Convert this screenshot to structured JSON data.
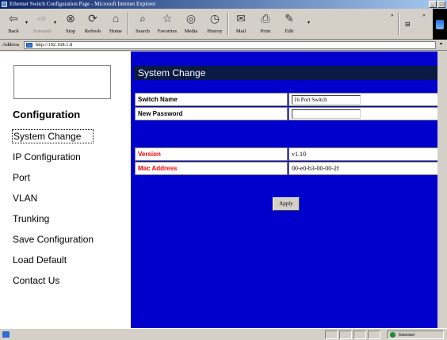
{
  "window": {
    "title": "Ethernet Switch Configuration Page - Microsoft Internet Explorer",
    "controls": [
      "_",
      "□"
    ]
  },
  "toolbar": {
    "buttons": [
      {
        "label": "Back",
        "icon": "back-arrow-icon",
        "glyph": "⇦"
      },
      {
        "label": "Forward",
        "icon": "forward-arrow-icon",
        "glyph": "⇨"
      },
      {
        "label": "Stop",
        "icon": "stop-icon",
        "glyph": "⊗"
      },
      {
        "label": "Refresh",
        "icon": "refresh-icon",
        "glyph": "⟳"
      },
      {
        "label": "Home",
        "icon": "home-icon",
        "glyph": "⌂"
      },
      {
        "label": "Search",
        "icon": "search-icon",
        "glyph": "⌕"
      },
      {
        "label": "Favorites",
        "icon": "favorites-icon",
        "glyph": "☆"
      },
      {
        "label": "Media",
        "icon": "media-icon",
        "glyph": "◎"
      },
      {
        "label": "History",
        "icon": "history-icon",
        "glyph": "◷"
      },
      {
        "label": "Mail",
        "icon": "mail-icon",
        "glyph": "✉"
      },
      {
        "label": "Print",
        "icon": "print-icon",
        "glyph": "⎙"
      },
      {
        "label": "Edit",
        "icon": "edit-icon",
        "glyph": "✎"
      }
    ]
  },
  "address": {
    "label": "Address",
    "url": "http://192.168.1.8"
  },
  "sidebar": {
    "section_title": "Configuration",
    "items": [
      "System Change",
      "IP Configuration",
      "Port",
      "VLAN",
      "Trunking",
      "Save Configuration",
      "Load Default",
      "Contact Us"
    ]
  },
  "main": {
    "title": "System Change",
    "switch_name_label": "Switch Name",
    "switch_name_value": "16 Port Switch",
    "new_password_label": "New Password",
    "new_password_value": "",
    "version_label": "Version",
    "version_value": "v1.10",
    "mac_label": "Mac Address",
    "mac_value": "00-e0-b3-00-00-2f",
    "apply_label": "Apply"
  },
  "status": {
    "zone": "Internet"
  },
  "colors": {
    "main_bg": "#0000cc",
    "title_bar_bg": "#0a1a44",
    "red_label": "#ff0000"
  }
}
